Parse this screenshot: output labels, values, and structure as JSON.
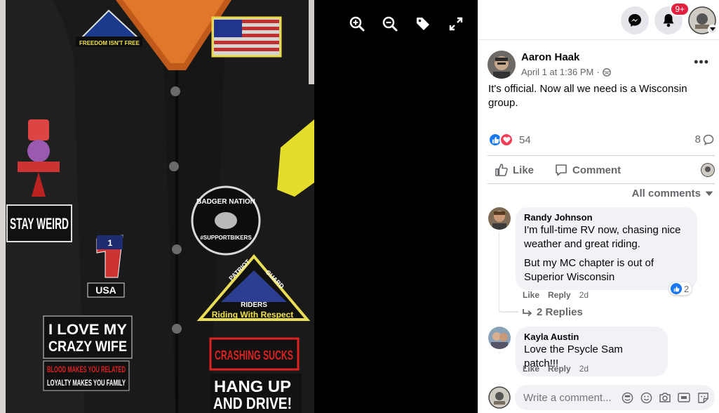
{
  "viewer": {
    "controls": [
      "zoom-in-icon",
      "zoom-out-icon",
      "tag-icon",
      "fullscreen-icon"
    ],
    "photo_patches": {
      "freedom": "FREEDOM ISN'T FREE",
      "stay_weird": "STAY WEIRD",
      "usa_number": "1",
      "usa": "USA",
      "badger_nation": "BADGER NATION",
      "support_bikers": "#SUPPORTBIKERS",
      "patriot": "PATRIOT",
      "guard": "GUARD",
      "riders": "RIDERS",
      "riding_with_respect": "Riding With Respect",
      "love_my": "I LOVE MY",
      "crazy_wife": "CRAZY WIFE",
      "blood_line1": "BLOOD MAKES YOU RELATED",
      "blood_line2": "LOYALTY MAKES YOU FAMILY",
      "crashing_sucks": "CRASHING SUCKS",
      "hang_up": "HANG UP",
      "and_drive": "AND DRIVE!"
    }
  },
  "topbar": {
    "notification_badge": "9+"
  },
  "post": {
    "author": "Aaron Haak",
    "time": "April 1 at 1:36 PM",
    "separator": "·",
    "text": "It's official. Now all we need is a Wisconsin group.",
    "reaction_count": "54",
    "comment_count": "8",
    "actions": {
      "like": "Like",
      "comment": "Comment"
    }
  },
  "filter": {
    "label": "All comments"
  },
  "comments": [
    {
      "name": "Randy Johnson",
      "text1": "I'm full-time RV now, chasing nice weather and great riding.",
      "text2": "But my MC chapter is out of Superior Wisconsin",
      "like": "Like",
      "reply": "Reply",
      "time": "2d",
      "likes": "2"
    },
    {
      "name": "Kayla Austin",
      "text1": "Love the Psycle Sam patch!!!",
      "like": "Like",
      "reply": "Reply",
      "time": "2d"
    }
  ],
  "replies_link": "2 Replies",
  "write": {
    "placeholder": "Write a comment..."
  },
  "colors": {
    "facebook_blue": "#1877f2",
    "love_red": "#f33e58",
    "gray_text": "#65676b",
    "bubble": "#f0f2f5"
  }
}
